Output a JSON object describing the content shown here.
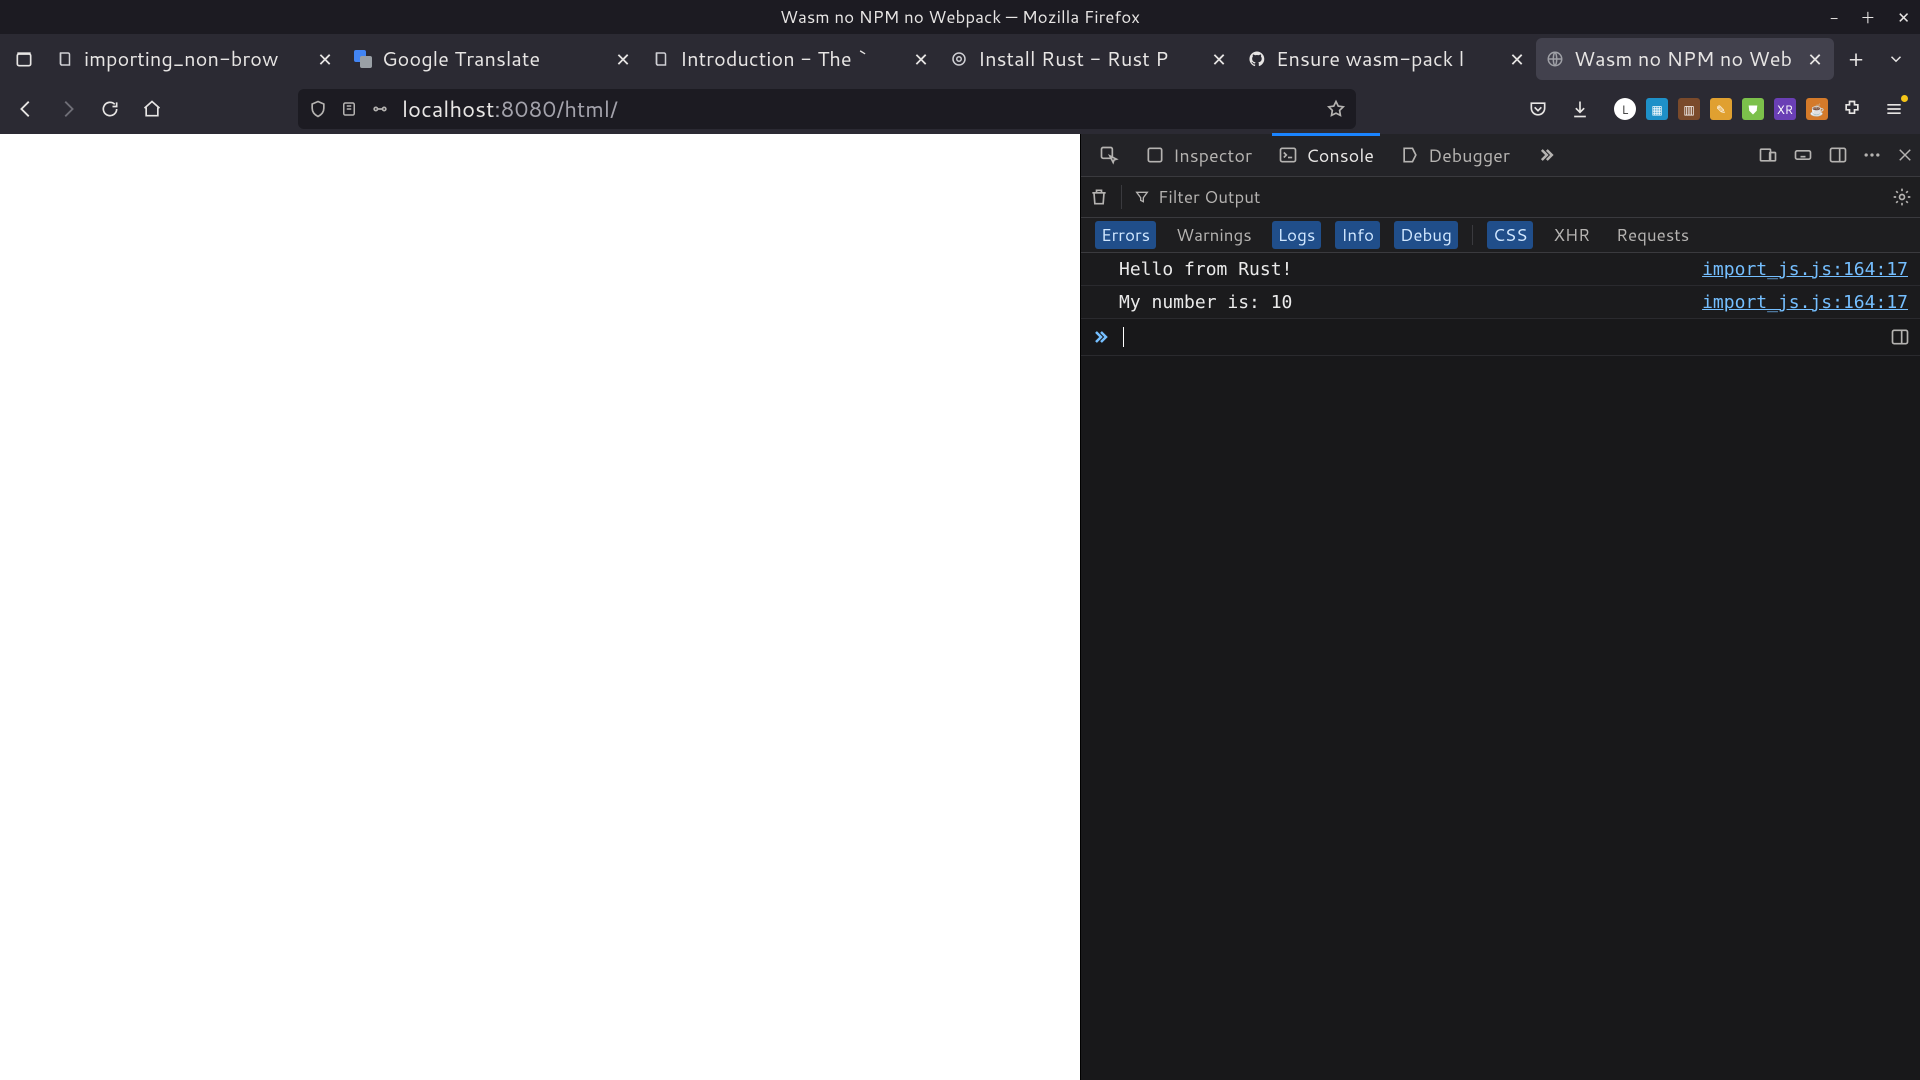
{
  "window_title": "Wasm no NPM no Webpack — Mozilla Firefox",
  "tabs": [
    {
      "label": "importing_non-brow",
      "favicon": "mdbook"
    },
    {
      "label": "Google Translate",
      "favicon": "gtranslate"
    },
    {
      "label": "Introduction - The `",
      "favicon": "mdbook"
    },
    {
      "label": "Install Rust - Rust P",
      "favicon": "rust"
    },
    {
      "label": "Ensure wasm-pack l",
      "favicon": "github"
    },
    {
      "label": "Wasm no NPM no Web",
      "favicon": "globe"
    }
  ],
  "active_tab_index": 5,
  "url": {
    "host": "localhost",
    "rest": ":8080/html/"
  },
  "devtools": {
    "tabs": [
      "Inspector",
      "Console",
      "Debugger"
    ],
    "active": "Console",
    "filter_placeholder": "Filter Output",
    "categories": [
      "Errors",
      "Warnings",
      "Logs",
      "Info",
      "Debug",
      "CSS",
      "XHR",
      "Requests"
    ],
    "active_categories": [
      "Errors",
      "Logs",
      "Info",
      "Debug",
      "CSS"
    ],
    "messages": [
      {
        "text": "Hello from Rust!",
        "src": "import_js.js:164:17"
      },
      {
        "text": "My number is: 10",
        "src": "import_js.js:164:17"
      }
    ]
  }
}
